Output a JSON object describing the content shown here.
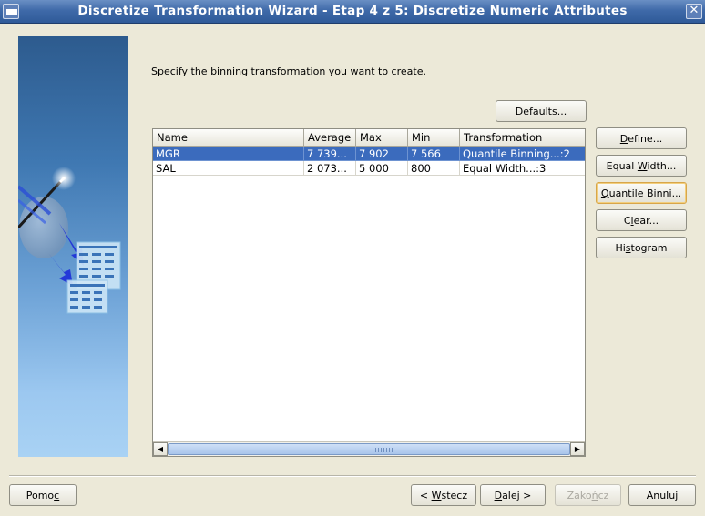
{
  "window": {
    "title": "Discretize Transformation Wizard - Etap 4 z 5: Discretize Numeric Attributes",
    "close_glyph": "✕"
  },
  "instruction": "Specify the binning transformation you want to create.",
  "buttons": {
    "defaults": {
      "before": "",
      "mnemonic": "D",
      "after": "efaults..."
    },
    "define": {
      "before": "",
      "mnemonic": "D",
      "after": "efine..."
    },
    "equal_width": {
      "before": "Equal ",
      "mnemonic": "W",
      "after": "idth..."
    },
    "quantile_binning": {
      "before": "",
      "mnemonic": "Q",
      "after": "uantile Binni..."
    },
    "clear": {
      "before": "C",
      "mnemonic": "l",
      "after": "ear..."
    },
    "histogram": {
      "before": "Hi",
      "mnemonic": "s",
      "after": "togram"
    }
  },
  "table": {
    "columns": [
      "Name",
      "Average",
      "Max",
      "Min",
      "Transformation"
    ],
    "rows": [
      {
        "name": "MGR",
        "average": "7 739...",
        "max": "7 902",
        "min": "7 566",
        "transformation": "Quantile Binning...:2",
        "selected": true
      },
      {
        "name": "SAL",
        "average": "2 073...",
        "max": "5 000",
        "min": "800",
        "transformation": "Equal Width...:3",
        "selected": false
      }
    ]
  },
  "footer": {
    "help": {
      "before": "Pomo",
      "mnemonic": "c",
      "after": ""
    },
    "back": {
      "before": "< ",
      "mnemonic": "W",
      "after": "stecz"
    },
    "next": {
      "before": "",
      "mnemonic": "D",
      "after": "alej >"
    },
    "finish": {
      "before": "Zako",
      "mnemonic": "ń",
      "after": "cz"
    },
    "cancel": {
      "before": "Anuluj",
      "mnemonic": "",
      "after": ""
    }
  },
  "colors": {
    "titlebar": "#3f6aa9",
    "selection": "#3b6bbd",
    "dialog_bg": "#ece9d8"
  }
}
